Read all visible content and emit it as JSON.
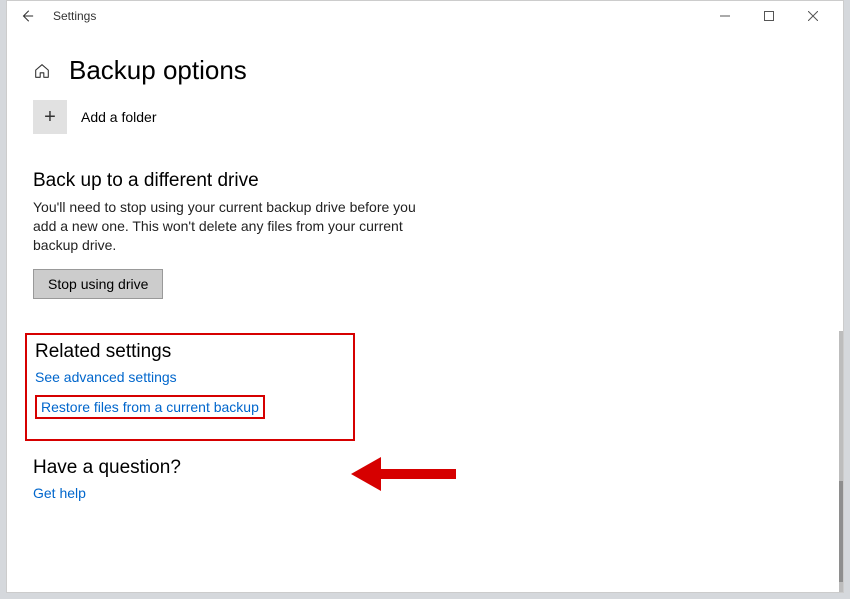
{
  "titlebar": {
    "app_name": "Settings"
  },
  "header": {
    "title": "Backup options"
  },
  "add_folder": {
    "label": "Add a folder"
  },
  "backup_drive": {
    "heading": "Back up to a different drive",
    "description": "You'll need to stop using your current backup drive before you add a new one. This won't delete any files from your current backup drive.",
    "button_label": "Stop using drive"
  },
  "related": {
    "heading": "Related settings",
    "advanced_link": "See advanced settings",
    "restore_link": "Restore files from a current backup"
  },
  "help": {
    "heading": "Have a question?",
    "link": "Get help"
  }
}
